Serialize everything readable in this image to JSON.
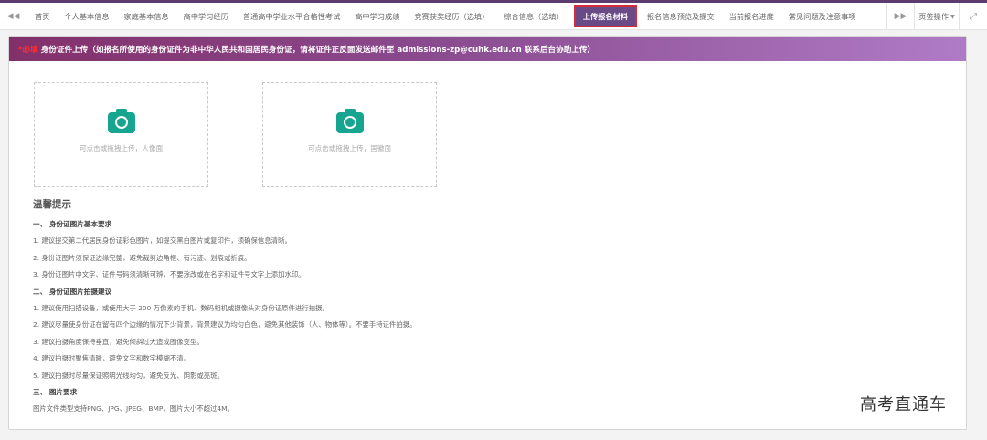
{
  "nav": {
    "tabs": [
      {
        "label": "首页"
      },
      {
        "label": "个人基本信息"
      },
      {
        "label": "家庭基本信息"
      },
      {
        "label": "高中学习经历"
      },
      {
        "label": "普通高中学业水平合格性考试"
      },
      {
        "label": "高中学习成绩"
      },
      {
        "label": "竞赛获奖经历（选填）"
      },
      {
        "label": "综合信息（选填）"
      },
      {
        "label": "上传报名材料",
        "active": true
      },
      {
        "label": "报名信息预览及提交"
      },
      {
        "label": "当前报名进度"
      },
      {
        "label": "常见问题及注意事项"
      }
    ],
    "page_ops_label": "页签操作"
  },
  "upload_panel": {
    "required_tag": "*必填",
    "title": "身份证件上传（如报名所使用的身份证件为非中华人民共和国居民身份证，请将证件正反面发送邮件至 admissions-zp@cuhk.edu.cn 联系后台协助上传）",
    "front_hint": "可点击或拖拽上传，人像面",
    "back_hint": "可点击或拖拽上传，国徽面"
  },
  "tips": {
    "title": "温馨提示",
    "sections": [
      {
        "heading": "一、 身份证图片基本要求",
        "items": [
          "1. 建议提交第二代居民身份证彩色图片，如提交黑白图片或复印件，须确保信息清晰。",
          "2. 身份证图片须保证边缘完整，避免裁剪边角框、有污迹、划痕或折痕。",
          "3. 身份证图片中文字、证件号码须清晰可辨，不要涂改或在名字和证件号文字上添加水印。"
        ]
      },
      {
        "heading": "二、 身份证图片拍摄建议",
        "items": [
          "1. 建议使用扫描设备，或使用大于 200 万像素的手机、数码相机或摄像头对身份证原件进行拍摄。",
          "2. 建议尽量使身份证在留有四个边缘的情况下少背景，背景建议为均匀白色，避免其他装饰（人、物体等）。不要手持证件拍摄。",
          "3. 建议拍摄角度保持垂直，避免倾斜过大造成图像变型。",
          "4. 建议拍摄时聚焦清晰，避免文字和数字模糊不清。",
          "5. 建议拍摄时尽量保证照明光线均匀，避免反光、阴影或亮斑。"
        ]
      },
      {
        "heading": "三、 图片要求",
        "items": [
          "图片文件类型支持PNG、JPG、JPEG、BMP，图片大小不超过4M。"
        ]
      }
    ]
  },
  "watermark": "高考直通车",
  "icons": {
    "tab_prev": "double-chevron-left-icon",
    "tab_next": "double-chevron-right-icon",
    "fullscreen": "expand-icon",
    "upload": "camera-icon"
  },
  "colors": {
    "accent": "#6a4a86",
    "active_tab_border": "#d42d3a",
    "header_gradient_start": "#83306a",
    "header_gradient_end": "#b07bc6",
    "camera": "#17a590",
    "required": "#ff2e2e"
  }
}
